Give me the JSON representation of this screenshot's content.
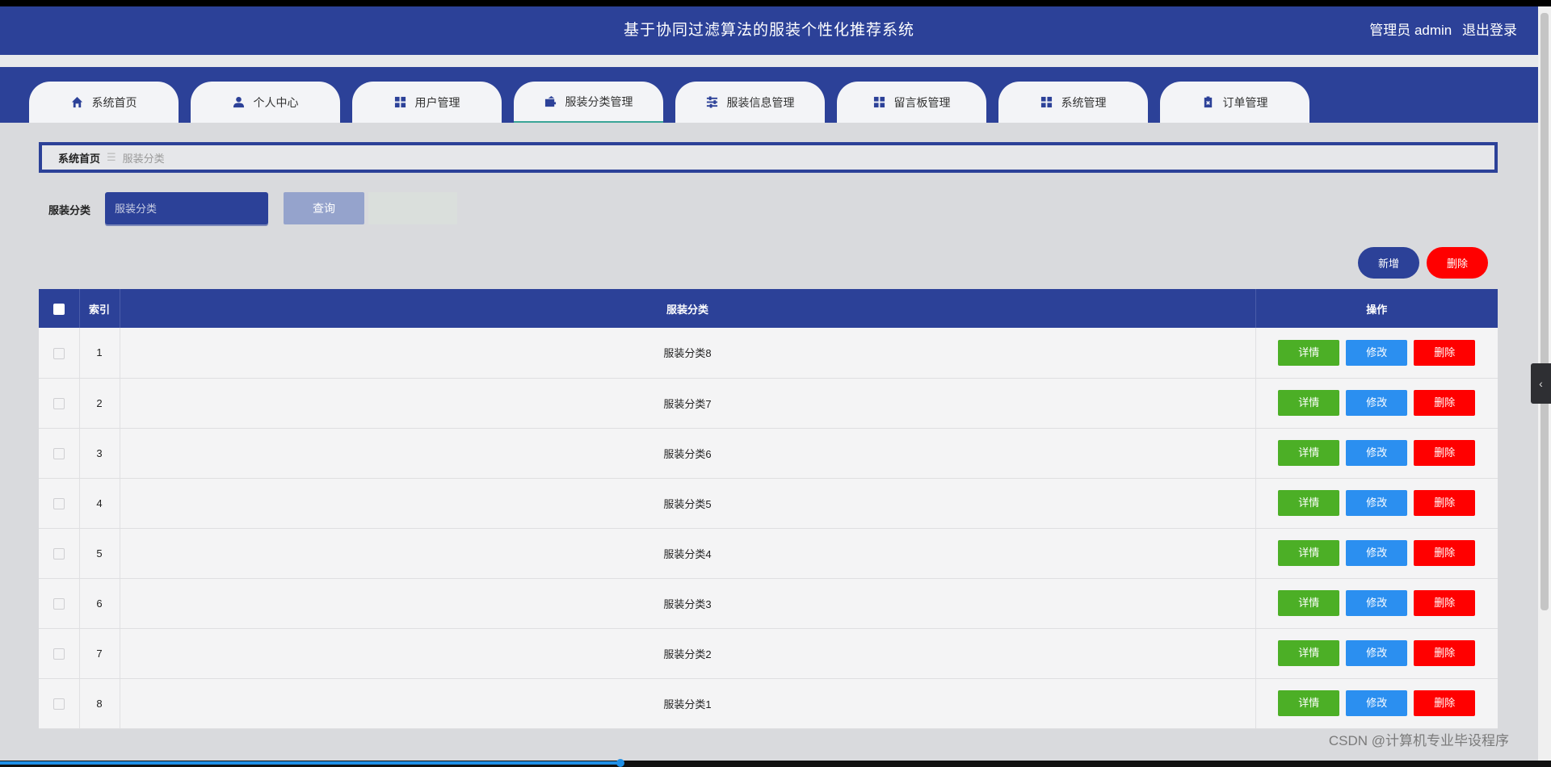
{
  "header": {
    "title": "基于协同过滤算法的服装个性化推荐系统",
    "user_label": "管理员 admin",
    "logout": "退出登录"
  },
  "nav": {
    "tabs": [
      {
        "label": "系统首页",
        "icon": "home-icon"
      },
      {
        "label": "个人中心",
        "icon": "user-icon"
      },
      {
        "label": "用户管理",
        "icon": "grid-icon"
      },
      {
        "label": "服装分类管理",
        "icon": "wallet-icon"
      },
      {
        "label": "服装信息管理",
        "icon": "sliders-icon"
      },
      {
        "label": "留言板管理",
        "icon": "grid-icon"
      },
      {
        "label": "系统管理",
        "icon": "grid-icon"
      },
      {
        "label": "订单管理",
        "icon": "clipboard-icon"
      }
    ],
    "active_index": 3
  },
  "breadcrumb": {
    "home": "系统首页",
    "separator": "☰",
    "current": "服装分类"
  },
  "search": {
    "label": "服装分类",
    "placeholder": "服装分类",
    "button": "查询"
  },
  "actions": {
    "add": "新增",
    "delete": "删除"
  },
  "table": {
    "headers": {
      "index": "索引",
      "category": "服装分类",
      "ops": "操作"
    },
    "rows": [
      {
        "index": "1",
        "category": "服装分类8"
      },
      {
        "index": "2",
        "category": "服装分类7"
      },
      {
        "index": "3",
        "category": "服装分类6"
      },
      {
        "index": "4",
        "category": "服装分类5"
      },
      {
        "index": "5",
        "category": "服装分类4"
      },
      {
        "index": "6",
        "category": "服装分类3"
      },
      {
        "index": "7",
        "category": "服装分类2"
      },
      {
        "index": "8",
        "category": "服装分类1"
      }
    ],
    "op_labels": {
      "detail": "详情",
      "edit": "修改",
      "remove": "删除"
    }
  },
  "watermark": "CSDN @计算机专业毕设程序",
  "video_progress": 0.4,
  "colors": {
    "primary": "#2c4198",
    "detail": "#4caf26",
    "edit": "#2b8ff0",
    "danger": "#ff0000"
  }
}
